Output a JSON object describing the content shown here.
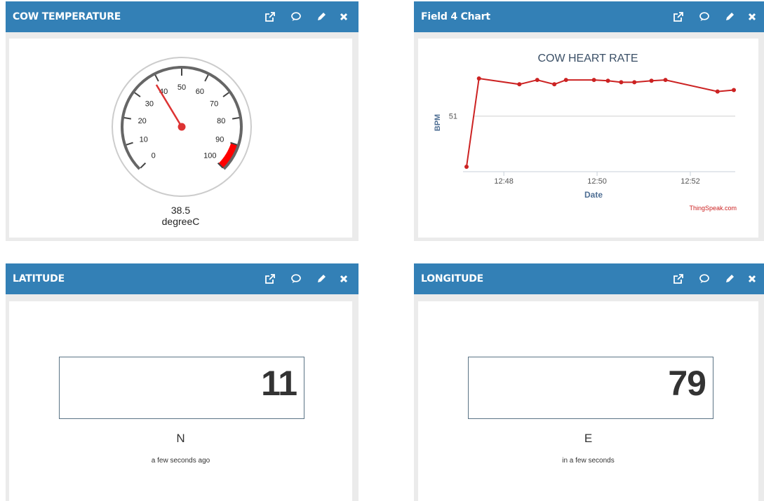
{
  "widgets": {
    "temperature": {
      "title": "COW TEMPERATURE",
      "gauge": {
        "value": 38.5,
        "value_text": "38.5",
        "unit": "degreeC",
        "min": 0,
        "max": 100,
        "ticks": [
          "0",
          "10",
          "20",
          "30",
          "40",
          "50",
          "60",
          "70",
          "80",
          "90",
          "100"
        ],
        "danger_from": 90,
        "danger_color": "#ff0000",
        "needle_color": "#dd3333"
      }
    },
    "heart_chart": {
      "title": "Field 4 Chart",
      "credit": "ThingSpeak.com"
    },
    "latitude": {
      "title": "LATITUDE",
      "value": "11",
      "unit": "N",
      "updated": "a few seconds ago"
    },
    "longitude": {
      "title": "LONGITUDE",
      "value": "79",
      "unit": "E",
      "updated": "in a few seconds"
    }
  },
  "header_icons": [
    "external-link-icon",
    "comment-icon",
    "pencil-icon",
    "close-icon"
  ],
  "colors": {
    "header": "#3380b6",
    "panel": "#ebebeb",
    "line": "#cc2222"
  },
  "chart_data": {
    "type": "line",
    "title": "COW HEART RATE",
    "xlabel": "Date",
    "ylabel": "BPM",
    "x_ticks": [
      "12:48",
      "12:50",
      "12:52"
    ],
    "y_ticks": [
      "51"
    ],
    "series": [
      {
        "values": [
          {
            "x": "12:47:12",
            "y": 49.25
          },
          {
            "x": "12:47:28",
            "y": 52.3
          },
          {
            "x": "12:48:20",
            "y": 52.1
          },
          {
            "x": "12:48:43",
            "y": 52.25
          },
          {
            "x": "12:49:05",
            "y": 52.1
          },
          {
            "x": "12:49:20",
            "y": 52.25
          },
          {
            "x": "12:49:56",
            "y": 52.25
          },
          {
            "x": "12:50:14",
            "y": 52.22
          },
          {
            "x": "12:50:31",
            "y": 52.17
          },
          {
            "x": "12:50:48",
            "y": 52.17
          },
          {
            "x": "12:51:10",
            "y": 52.22
          },
          {
            "x": "12:51:28",
            "y": 52.25
          },
          {
            "x": "12:52:35",
            "y": 51.85
          },
          {
            "x": "12:52:56",
            "y": 51.9
          }
        ]
      }
    ],
    "grid": false
  }
}
